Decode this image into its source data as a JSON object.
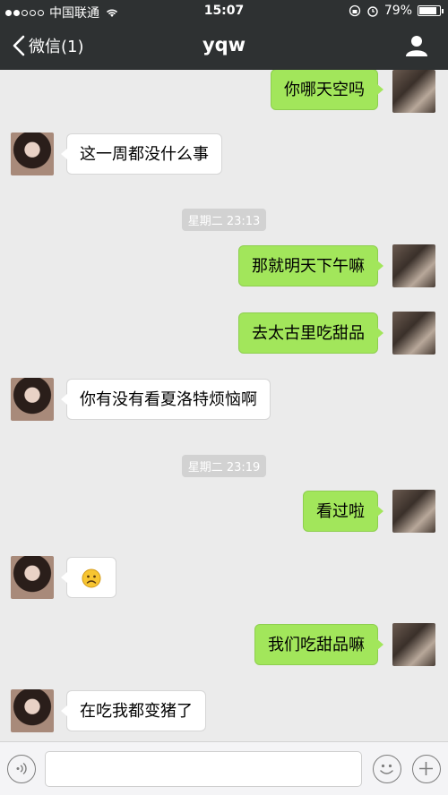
{
  "status_bar": {
    "carrier": "中国联通",
    "time": "15:07",
    "battery": "79%"
  },
  "nav": {
    "back_label": "微信(1)",
    "title": "yqw"
  },
  "messages": [
    {
      "from": "me",
      "text": "你哪天空吗"
    },
    {
      "from": "them",
      "text": "这一周都没什么事"
    },
    {
      "type": "timestamp",
      "text": "星期二 23:13"
    },
    {
      "from": "me",
      "text": "那就明天下午嘛"
    },
    {
      "from": "me",
      "text": "去太古里吃甜品"
    },
    {
      "from": "them",
      "text": "你有没有看夏洛特烦恼啊"
    },
    {
      "type": "timestamp",
      "text": "星期二 23:19"
    },
    {
      "from": "me",
      "text": "看过啦"
    },
    {
      "from": "them",
      "emoji": "sad-face"
    },
    {
      "from": "me",
      "text": "我们吃甜品嘛"
    },
    {
      "from": "them",
      "text": "在吃我都变猪了"
    }
  ],
  "colors": {
    "navbar": "#2e3132",
    "bubble_out": "#a2e65b",
    "bubble_in": "#ffffff",
    "chat_bg": "#ebebeb"
  }
}
